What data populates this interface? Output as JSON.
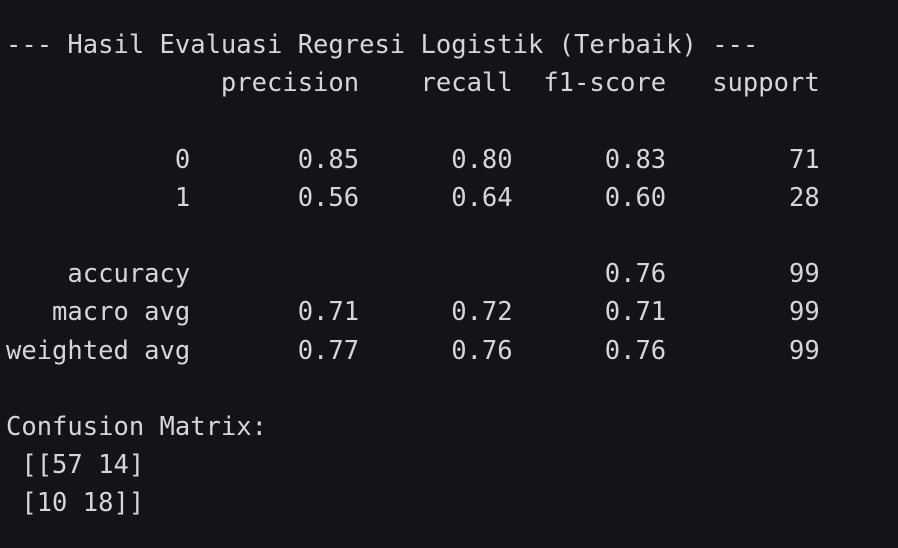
{
  "output": {
    "lines": [
      "--- Hasil Evaluasi Regresi Logistik (Terbaik) ---",
      "              precision    recall  f1-score   support",
      "",
      "           0       0.85      0.80      0.83        71",
      "           1       0.56      0.64      0.60        28",
      "",
      "    accuracy                           0.76        99",
      "   macro avg       0.71      0.72      0.71        99",
      "weighted avg       0.77      0.76      0.76        99",
      "",
      "Confusion Matrix:",
      " [[57 14]",
      " [10 18]]"
    ]
  }
}
